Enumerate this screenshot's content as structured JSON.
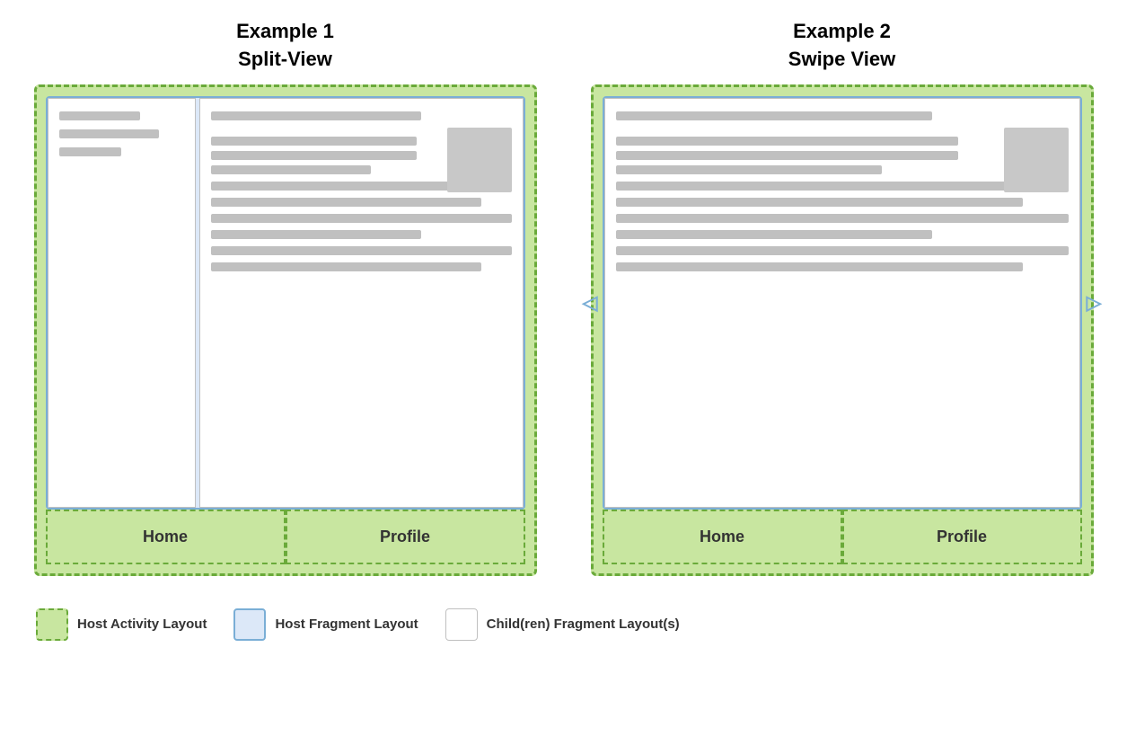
{
  "example1": {
    "title_line1": "Example 1",
    "title_line2": "Split-View",
    "nav_home": "Home",
    "nav_profile": "Profile"
  },
  "example2": {
    "title_line1": "Example 2",
    "title_line2": "Swipe View",
    "nav_home": "Home",
    "nav_profile": "Profile"
  },
  "legend": {
    "item1": "Host Activity Layout",
    "item2": "Host Fragment Layout",
    "item3": "Child(ren) Fragment Layout(s)"
  },
  "arrows": {
    "left": "◁",
    "right": "▷"
  }
}
